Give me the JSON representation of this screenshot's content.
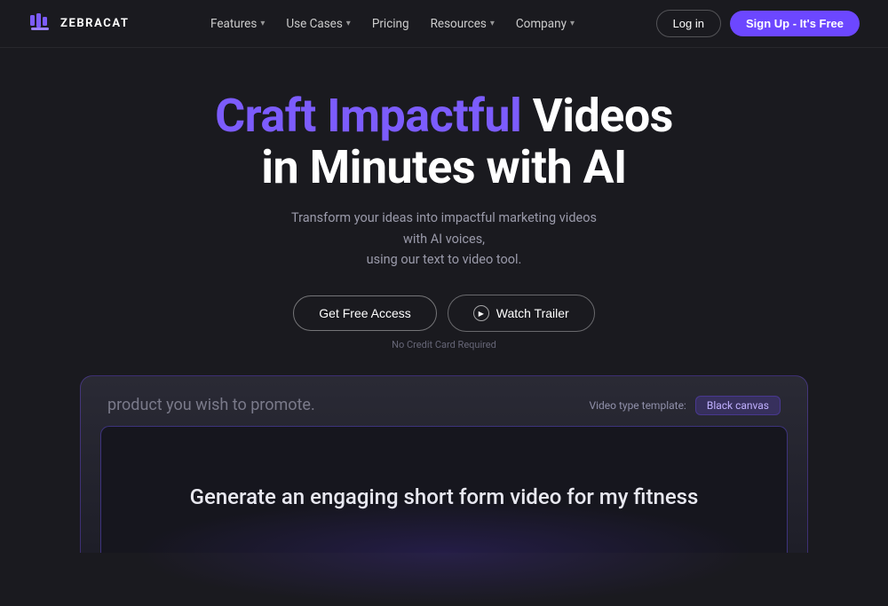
{
  "brand": {
    "logo_text": "ZEBRACAT",
    "logo_icon_label": "zebracat-logo"
  },
  "navbar": {
    "features_label": "Features",
    "use_cases_label": "Use Cases",
    "pricing_label": "Pricing",
    "resources_label": "Resources",
    "company_label": "Company",
    "login_label": "Log in",
    "signup_label": "Sign Up - It's Free"
  },
  "hero": {
    "title_part1_purple": "Craft Impactful",
    "title_part1_white": " Videos",
    "title_part2_white": "in Minutes ",
    "title_part2_normal": "with AI",
    "subtitle_line1": "Transform your ideas into impactful marketing videos with AI voices,",
    "subtitle_line2": "using our text to video tool.",
    "btn_cta": "Get Free Access",
    "btn_trailer": "Watch Trailer",
    "no_cc_text": "No Credit Card Required"
  },
  "video_preview": {
    "promo_text": "product you wish to promote.",
    "label_text": "Video type template:",
    "tag_text": "Black canvas",
    "main_text": "Generate an engaging short form video for my fitness"
  },
  "colors": {
    "accent_purple": "#7c5cfc",
    "bg_dark": "#1a1a1f",
    "nav_border": "rgba(255,255,255,0.06)"
  }
}
